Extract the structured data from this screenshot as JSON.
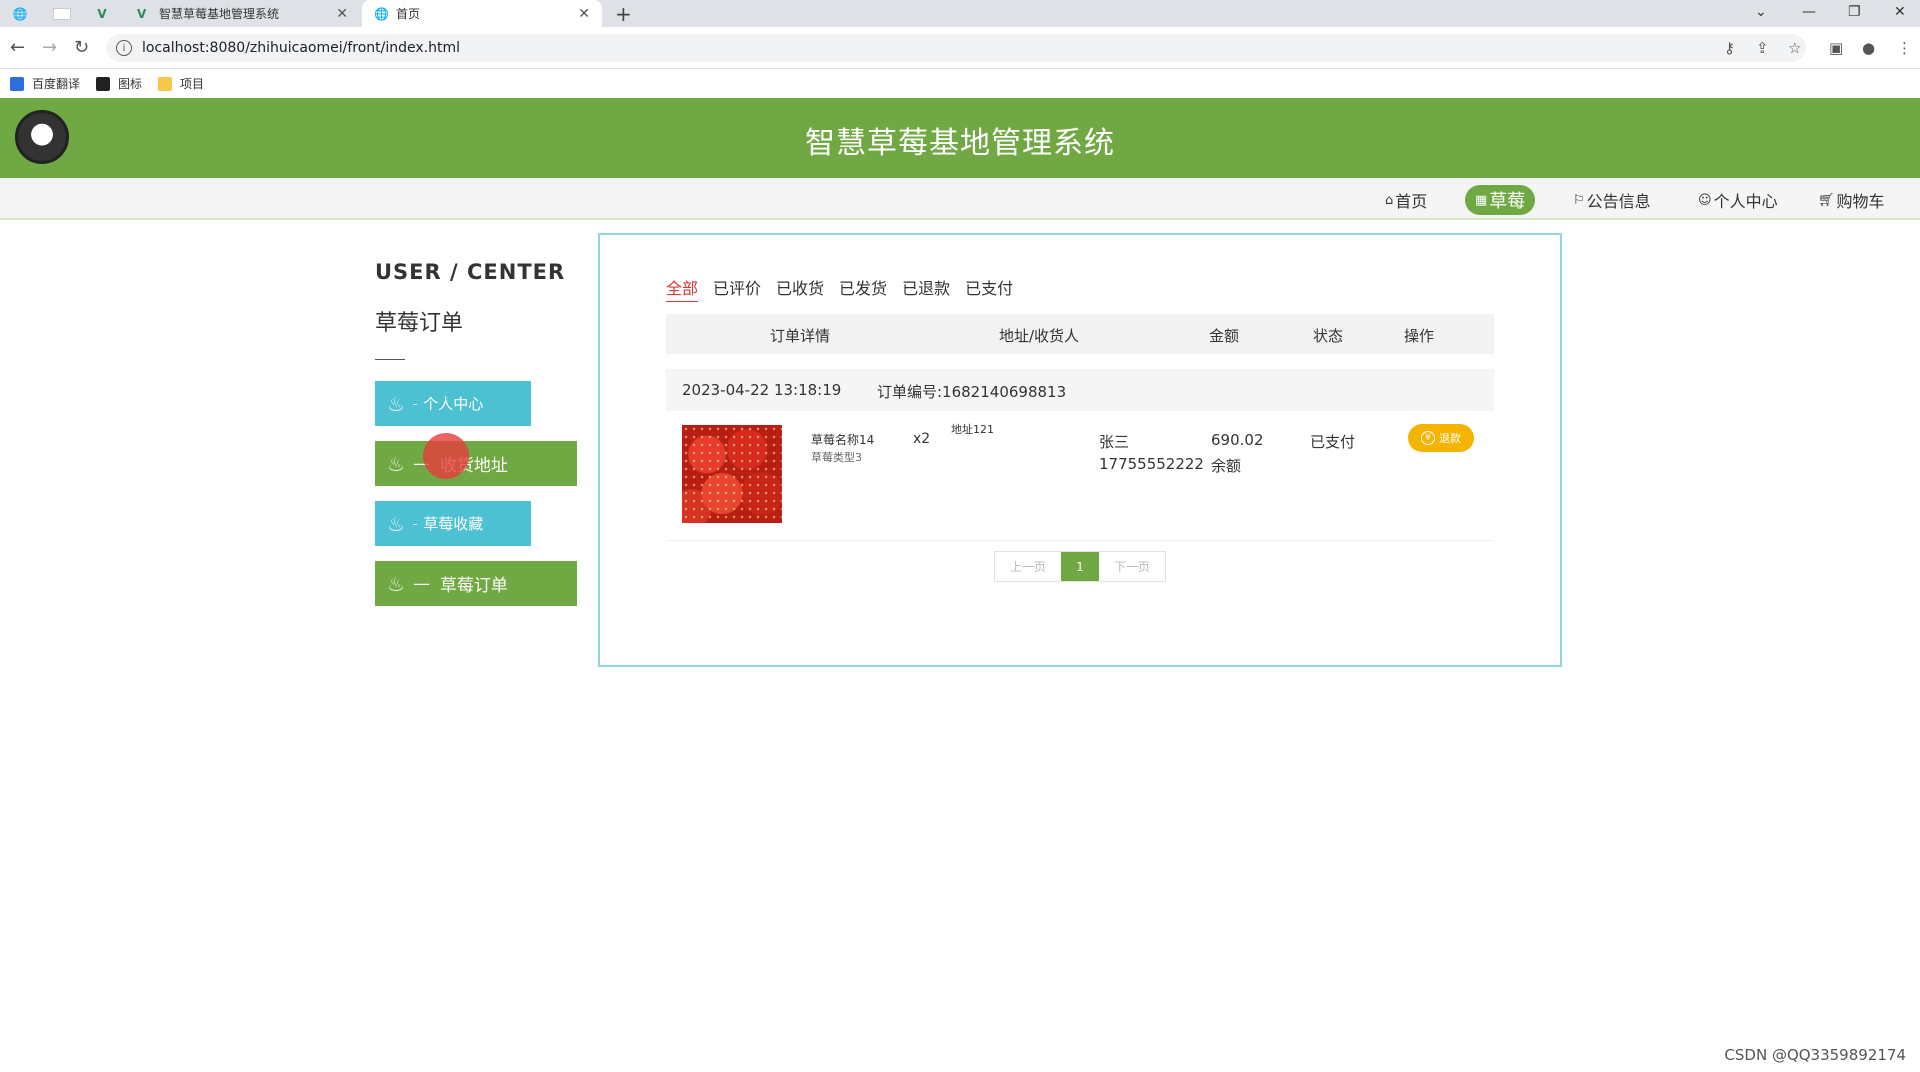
{
  "browser": {
    "tabs": [
      {
        "title": "智慧草莓基地管理系统"
      },
      {
        "title": "首页"
      }
    ],
    "url": "localhost:8080/zhihuicaomei/front/index.html",
    "bookmarks": [
      "百度翻译",
      "图标",
      "项目"
    ]
  },
  "site": {
    "title": "智慧草莓基地管理系统",
    "nav": [
      "首页",
      "草莓",
      "公告信息",
      "个人中心",
      "购物车"
    ],
    "active_nav": "草莓"
  },
  "user_center": {
    "title": "USER / CENTER",
    "subtitle": "草莓订单",
    "menu": [
      {
        "label": "个人中心",
        "prefix": "-"
      },
      {
        "label": "收货地址",
        "prefix": "—"
      },
      {
        "label": "草莓收藏",
        "prefix": "-"
      },
      {
        "label": "草莓订单",
        "prefix": "—"
      }
    ]
  },
  "orders": {
    "tabs": [
      "全部",
      "已评价",
      "已收货",
      "已发货",
      "已退款",
      "已支付"
    ],
    "active_tab": "全部",
    "columns": [
      "订单详情",
      "地址/收货人",
      "金额",
      "状态",
      "操作"
    ],
    "items": [
      {
        "time": "2023-04-22 13:18:19",
        "order_no": "订单编号:1682140698813",
        "product_name": "草莓名称14",
        "product_type": "草莓类型3",
        "quantity": "x2",
        "address": "地址121",
        "receiver": "张三",
        "phone": "17755552222",
        "amount": "690.02",
        "pay_method": "余额",
        "status": "已支付",
        "action": "退款"
      }
    ],
    "pager": {
      "prev": "上一页",
      "current": "1",
      "next": "下一页"
    }
  },
  "watermark": "CSDN @QQ3359892174",
  "colors": {
    "brand_green": "#70a843",
    "accent_blue": "#4dc0d1",
    "refund_orange": "#f5b400"
  }
}
